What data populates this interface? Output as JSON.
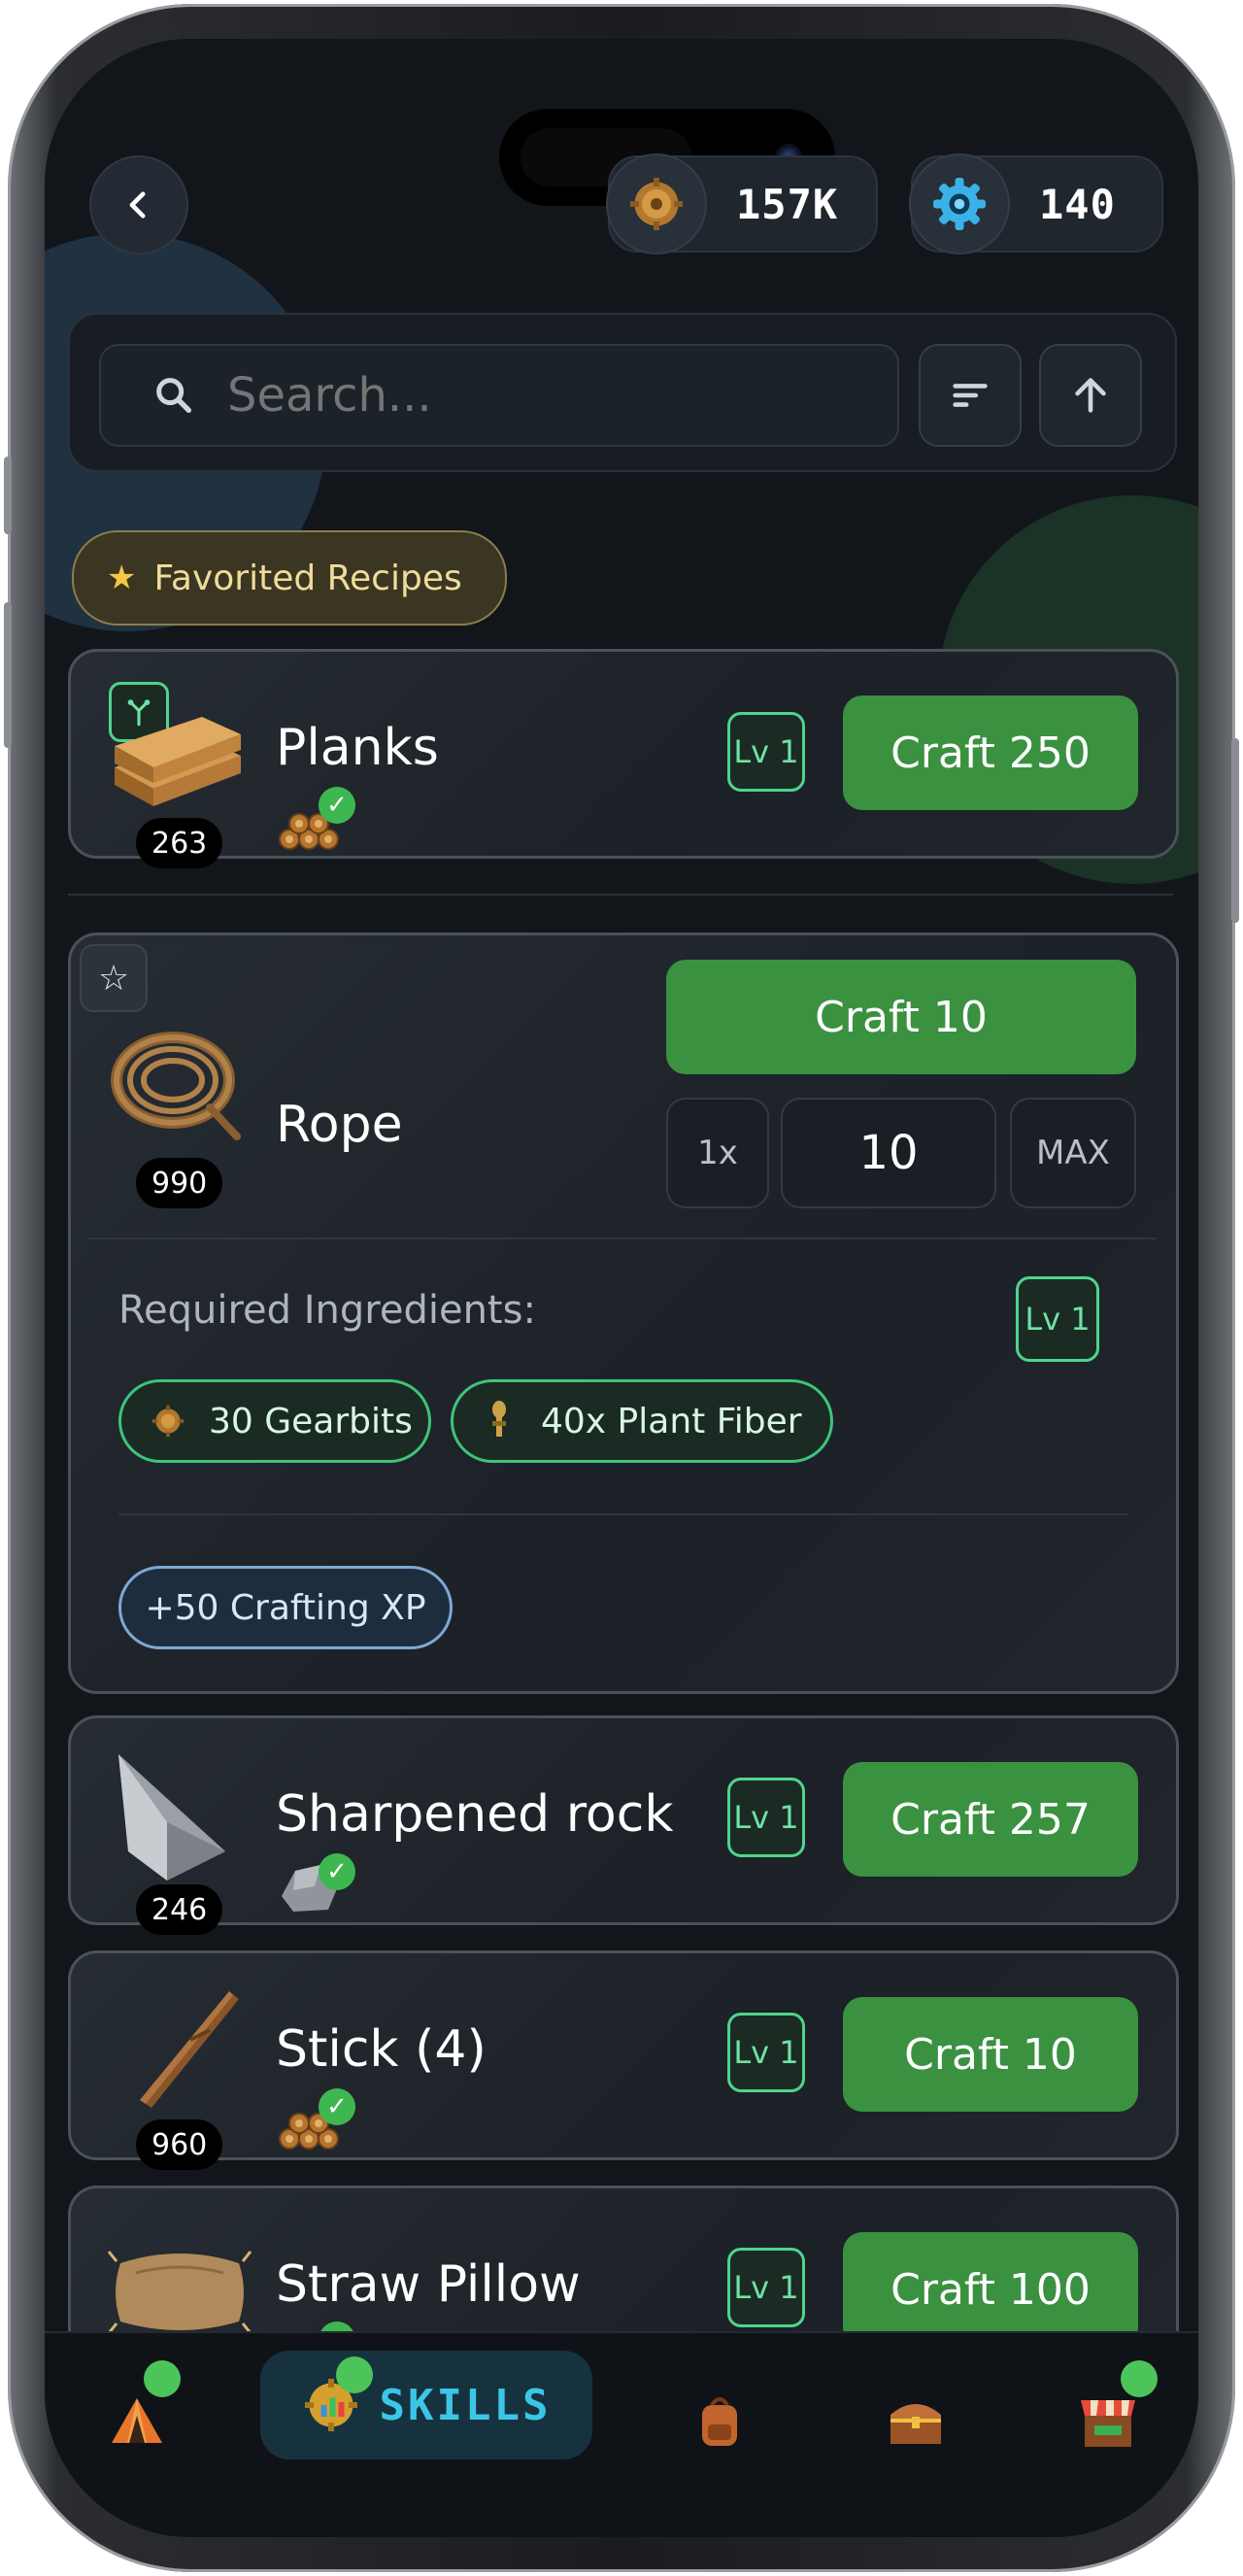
{
  "header": {
    "back_icon": "chevron-left-icon",
    "gearbits": {
      "icon": "gear-coin-icon",
      "value": "157K"
    },
    "gems": {
      "icon": "blue-gear-icon",
      "value": "140"
    }
  },
  "search": {
    "placeholder": "Search...",
    "value": ""
  },
  "favorites_chip": {
    "label": "Favorited Recipes"
  },
  "recipes": [
    {
      "name": "Planks",
      "count": "263",
      "level": "Lv 1",
      "craft_label": "Craft 250"
    },
    {
      "name": "Rope",
      "count": "990",
      "craft_label": "Craft 10",
      "qty_min": "1x",
      "qty_value": "10",
      "qty_max": "MAX",
      "ingredients_label": "Required Ingredients:",
      "level": "Lv 1",
      "ingredients": [
        {
          "label": "30 Gearbits"
        },
        {
          "label": "40x Plant Fiber"
        }
      ],
      "xp_label": "+50 Crafting XP"
    },
    {
      "name": "Sharpened rock",
      "count": "246",
      "level": "Lv 1",
      "craft_label": "Craft 257"
    },
    {
      "name": "Stick (4)",
      "count": "960",
      "level": "Lv 1",
      "craft_label": "Craft 10"
    },
    {
      "name": "Straw Pillow",
      "count": "",
      "level": "Lv 1",
      "craft_label": "Craft 100"
    }
  ],
  "nav": {
    "skills_label": "SKILLS",
    "items": [
      "camp-icon",
      "skills-icon",
      "backpack-icon",
      "chest-icon",
      "shop-icon"
    ]
  },
  "colors": {
    "accent_green": "#3a9140",
    "level_green": "#4fd48d",
    "background": "#12161b"
  }
}
